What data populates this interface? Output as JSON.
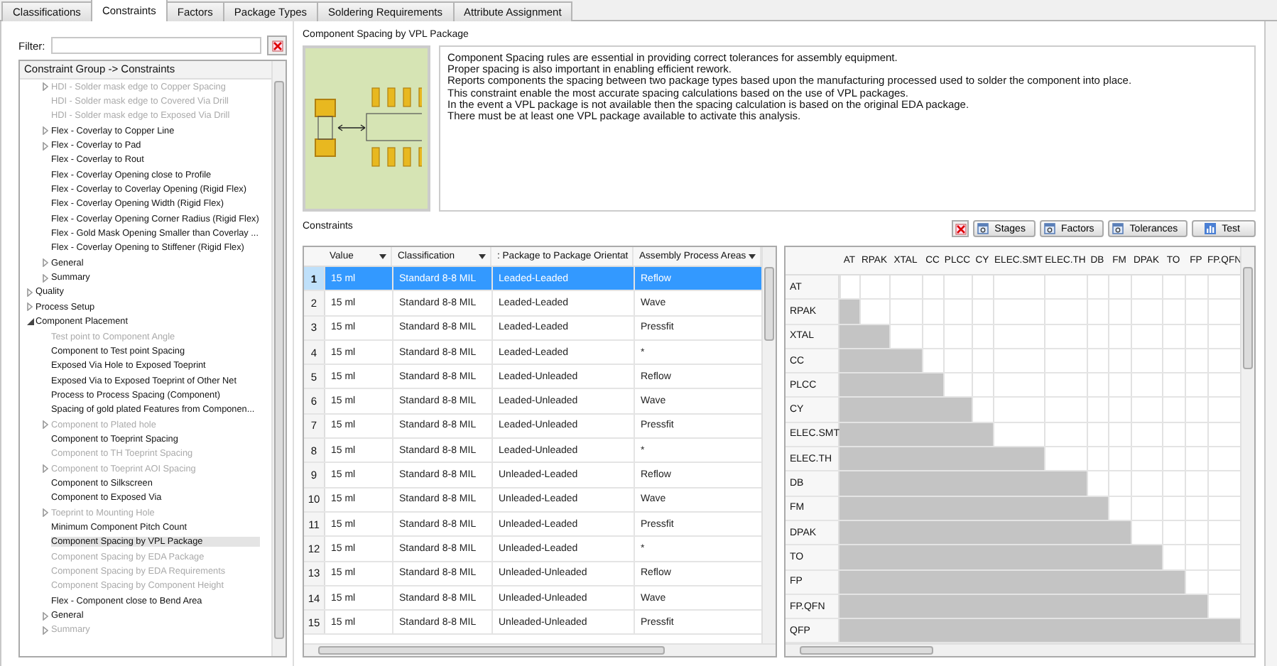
{
  "tabs": [
    {
      "label": "Classifications",
      "selected": false
    },
    {
      "label": "Constraints",
      "selected": true
    },
    {
      "label": "Factors",
      "selected": false
    },
    {
      "label": "Package Types",
      "selected": false
    },
    {
      "label": "Soldering Requirements",
      "selected": false
    },
    {
      "label": "Attribute Assignment",
      "selected": false
    }
  ],
  "filter": {
    "label": "Filter:"
  },
  "tree": {
    "header": "Constraint Group -> Constraints",
    "items": [
      {
        "kind": "continuation",
        "children": [
          {
            "label": "HDI - Solder mask edge to Copper Spacing",
            "disabled": true,
            "selected": false,
            "expanded": false
          },
          {
            "label": "HDI - Solder mask edge to Covered Via Drill",
            "disabled": true,
            "selected": false
          },
          {
            "label": "HDI - Solder mask edge to Exposed Via Drill",
            "disabled": true,
            "selected": false
          },
          {
            "label": "Flex - Coverlay to Copper Line",
            "disabled": false,
            "selected": false,
            "expanded": false
          },
          {
            "label": "Flex - Coverlay to Pad",
            "disabled": false,
            "selected": false,
            "expanded": false
          },
          {
            "label": "Flex - Coverlay to Rout",
            "disabled": false,
            "selected": false
          },
          {
            "label": "Flex - Coverlay Opening close to Profile",
            "disabled": false,
            "selected": false
          },
          {
            "label": "Flex - Coverlay to Coverlay Opening (Rigid Flex)",
            "disabled": false,
            "selected": false
          },
          {
            "label": "Flex - Coverlay Opening Width  (Rigid Flex)",
            "disabled": false,
            "selected": false
          },
          {
            "label": "Flex - Coverlay Opening Corner Radius (Rigid Flex)",
            "disabled": false,
            "selected": false
          },
          {
            "label": "Flex - Gold Mask Opening Smaller than Coverlay ...",
            "disabled": false,
            "selected": false
          },
          {
            "label": "Flex - Coverlay Opening to Stiffener  (Rigid Flex)",
            "disabled": false,
            "selected": false
          },
          {
            "label": "General",
            "disabled": false,
            "selected": false,
            "expanded": false
          },
          {
            "label": "Summary",
            "disabled": false,
            "selected": false,
            "expanded": false
          }
        ]
      },
      {
        "label": "Quality",
        "disabled": false,
        "selected": false,
        "expanded": false
      },
      {
        "label": "Process Setup",
        "disabled": false,
        "selected": false,
        "expanded": false
      },
      {
        "label": "Component Placement",
        "disabled": false,
        "selected": false,
        "expanded": true,
        "children": [
          {
            "label": "Test point to Component Angle",
            "disabled": true,
            "selected": false
          },
          {
            "label": "Component to Test point Spacing",
            "disabled": false,
            "selected": false
          },
          {
            "label": "Exposed Via Hole to Exposed Toeprint",
            "disabled": false,
            "selected": false
          },
          {
            "label": "Exposed Via to Exposed Toeprint of Other Net",
            "disabled": false,
            "selected": false
          },
          {
            "label": "Process to Process Spacing (Component)",
            "disabled": false,
            "selected": false
          },
          {
            "label": "Spacing of gold plated Features from Componen...",
            "disabled": false,
            "selected": false
          },
          {
            "label": "Component to Plated hole",
            "disabled": true,
            "selected": false,
            "expanded": false
          },
          {
            "label": "Component to Toeprint Spacing",
            "disabled": false,
            "selected": false
          },
          {
            "label": "Component to TH Toeprint Spacing",
            "disabled": true,
            "selected": false
          },
          {
            "label": "Component to Toeprint AOI Spacing",
            "disabled": true,
            "selected": false,
            "expanded": false
          },
          {
            "label": "Component to Silkscreen",
            "disabled": false,
            "selected": false
          },
          {
            "label": "Component to Exposed Via",
            "disabled": false,
            "selected": false
          },
          {
            "label": "Toeprint to Mounting Hole",
            "disabled": true,
            "selected": false,
            "expanded": false
          },
          {
            "label": "Minimum Component Pitch Count",
            "disabled": false,
            "selected": false
          },
          {
            "label": "Component Spacing by VPL Package",
            "disabled": false,
            "selected": true
          },
          {
            "label": "Component Spacing by EDA Package",
            "disabled": true,
            "selected": false
          },
          {
            "label": "Component Spacing by EDA Requirements",
            "disabled": true,
            "selected": false
          },
          {
            "label": "Component Spacing by Component Height",
            "disabled": true,
            "selected": false
          },
          {
            "label": "Flex - Component close to Bend Area",
            "disabled": false,
            "selected": false
          },
          {
            "label": "General",
            "disabled": false,
            "selected": false,
            "expanded": false
          },
          {
            "label": "Summary",
            "disabled": true,
            "selected": false,
            "expanded": false
          }
        ]
      }
    ]
  },
  "detail": {
    "title": "Component Spacing by VPL Package",
    "description": [
      "Component Spacing rules are essential in providing correct tolerances for assembly equipment.",
      "Proper spacing is also important in enabling efficient rework.",
      "Reports components the spacing between two package types based upon the manufacturing processed used to solder the component into place.",
      "This constraint enable the most accurate spacing calculations based on the use of VPL packages.",
      "In the event a VPL package is not available then the spacing calculation is based on the original EDA package.",
      "There must be at least one VPL package available to activate this analysis."
    ]
  },
  "constraints": {
    "title": "Constraints",
    "buttons": [
      {
        "label": "Stages"
      },
      {
        "label": "Factors"
      },
      {
        "label": "Tolerances"
      },
      {
        "label": "Test"
      }
    ],
    "columns": [
      "Value",
      "Classification",
      ": Package to Package Orientat",
      "Assembly Process Areas"
    ],
    "rows": [
      {
        "number": "1",
        "cells": [
          "15 ml",
          "Standard 8-8 MIL",
          "Leaded-Leaded",
          "Reflow"
        ],
        "selected": true
      },
      {
        "number": "2",
        "cells": [
          "15 ml",
          "Standard 8-8 MIL",
          "Leaded-Leaded",
          "Wave"
        ],
        "selected": false
      },
      {
        "number": "3",
        "cells": [
          "15 ml",
          "Standard 8-8 MIL",
          "Leaded-Leaded",
          "Pressfit"
        ],
        "selected": false
      },
      {
        "number": "4",
        "cells": [
          "15 ml",
          "Standard 8-8 MIL",
          "Leaded-Leaded",
          "*"
        ],
        "selected": false
      },
      {
        "number": "5",
        "cells": [
          "15 ml",
          "Standard 8-8 MIL",
          "Leaded-Unleaded",
          "Reflow"
        ],
        "selected": false
      },
      {
        "number": "6",
        "cells": [
          "15 ml",
          "Standard 8-8 MIL",
          "Leaded-Unleaded",
          "Wave"
        ],
        "selected": false
      },
      {
        "number": "7",
        "cells": [
          "15 ml",
          "Standard 8-8 MIL",
          "Leaded-Unleaded",
          "Pressfit"
        ],
        "selected": false
      },
      {
        "number": "8",
        "cells": [
          "15 ml",
          "Standard 8-8 MIL",
          "Leaded-Unleaded",
          "*"
        ],
        "selected": false
      },
      {
        "number": "9",
        "cells": [
          "15 ml",
          "Standard 8-8 MIL",
          "Unleaded-Leaded",
          "Reflow"
        ],
        "selected": false
      },
      {
        "number": "10",
        "cells": [
          "15 ml",
          "Standard 8-8 MIL",
          "Unleaded-Leaded",
          "Wave"
        ],
        "selected": false
      },
      {
        "number": "11",
        "cells": [
          "15 ml",
          "Standard 8-8 MIL",
          "Unleaded-Leaded",
          "Pressfit"
        ],
        "selected": false
      },
      {
        "number": "12",
        "cells": [
          "15 ml",
          "Standard 8-8 MIL",
          "Unleaded-Leaded",
          "*"
        ],
        "selected": false
      },
      {
        "number": "13",
        "cells": [
          "15 ml",
          "Standard 8-8 MIL",
          "Unleaded-Unleaded",
          "Reflow"
        ],
        "selected": false
      },
      {
        "number": "14",
        "cells": [
          "15 ml",
          "Standard 8-8 MIL",
          "Unleaded-Unleaded",
          "Wave"
        ],
        "selected": false
      },
      {
        "number": "15",
        "cells": [
          "15 ml",
          "Standard 8-8 MIL",
          "Unleaded-Unleaded",
          "Pressfit"
        ],
        "selected": false
      }
    ]
  },
  "matrix": {
    "columns": [
      "AT",
      "RPAK",
      "XTAL",
      "CC",
      "PLCC",
      "CY",
      "ELEC.SMT",
      "ELEC.TH",
      "DB",
      "FM",
      "DPAK",
      "TO",
      "FP",
      "FP.QFN"
    ],
    "rows": [
      {
        "label": "AT",
        "shaded": [
          false,
          false,
          false,
          false,
          false,
          false,
          false,
          false,
          false,
          false,
          false,
          false,
          false,
          false
        ]
      },
      {
        "label": "RPAK",
        "shaded": [
          true,
          false,
          false,
          false,
          false,
          false,
          false,
          false,
          false,
          false,
          false,
          false,
          false,
          false
        ]
      },
      {
        "label": "XTAL",
        "shaded": [
          true,
          true,
          false,
          false,
          false,
          false,
          false,
          false,
          false,
          false,
          false,
          false,
          false,
          false
        ]
      },
      {
        "label": "CC",
        "shaded": [
          true,
          true,
          true,
          false,
          false,
          false,
          false,
          false,
          false,
          false,
          false,
          false,
          false,
          false
        ]
      },
      {
        "label": "PLCC",
        "shaded": [
          true,
          true,
          true,
          true,
          false,
          false,
          false,
          false,
          false,
          false,
          false,
          false,
          false,
          false
        ]
      },
      {
        "label": "CY",
        "shaded": [
          true,
          true,
          true,
          true,
          true,
          false,
          false,
          false,
          false,
          false,
          false,
          false,
          false,
          false
        ]
      },
      {
        "label": "ELEC.SMT",
        "shaded": [
          true,
          true,
          true,
          true,
          true,
          true,
          false,
          false,
          false,
          false,
          false,
          false,
          false,
          false
        ]
      },
      {
        "label": "ELEC.TH",
        "shaded": [
          true,
          true,
          true,
          true,
          true,
          true,
          true,
          false,
          false,
          false,
          false,
          false,
          false,
          false
        ]
      },
      {
        "label": "DB",
        "shaded": [
          true,
          true,
          true,
          true,
          true,
          true,
          true,
          true,
          false,
          false,
          false,
          false,
          false,
          false
        ]
      },
      {
        "label": "FM",
        "shaded": [
          true,
          true,
          true,
          true,
          true,
          true,
          true,
          true,
          true,
          false,
          false,
          false,
          false,
          false
        ]
      },
      {
        "label": "DPAK",
        "shaded": [
          true,
          true,
          true,
          true,
          true,
          true,
          true,
          true,
          true,
          true,
          false,
          false,
          false,
          false
        ]
      },
      {
        "label": "TO",
        "shaded": [
          true,
          true,
          true,
          true,
          true,
          true,
          true,
          true,
          true,
          true,
          true,
          false,
          false,
          false
        ]
      },
      {
        "label": "FP",
        "shaded": [
          true,
          true,
          true,
          true,
          true,
          true,
          true,
          true,
          true,
          true,
          true,
          true,
          false,
          false
        ]
      },
      {
        "label": "FP.QFN",
        "shaded": [
          true,
          true,
          true,
          true,
          true,
          true,
          true,
          true,
          true,
          true,
          true,
          true,
          true,
          false
        ]
      },
      {
        "label": "QFP",
        "shaded": [
          true,
          true,
          true,
          true,
          true,
          true,
          true,
          true,
          true,
          true,
          true,
          true,
          true,
          true
        ]
      }
    ]
  }
}
